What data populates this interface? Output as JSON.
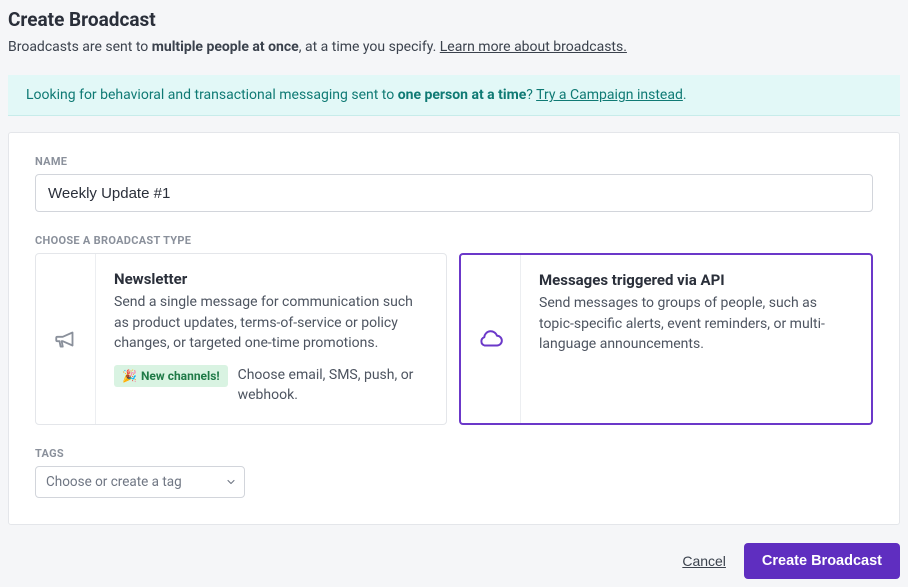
{
  "header": {
    "title": "Create Broadcast",
    "subtitle_pre": "Broadcasts are sent to ",
    "subtitle_bold": "multiple people at once",
    "subtitle_post": ", at a time you specify. ",
    "learn_more": "Learn more about broadcasts."
  },
  "banner": {
    "text_pre": "Looking for behavioral and transactional messaging sent to ",
    "text_bold": "one person at a time",
    "text_post": "? ",
    "link": "Try a Campaign instead",
    "tail": "."
  },
  "form": {
    "name_label": "NAME",
    "name_value": "Weekly Update #1",
    "type_label": "CHOOSE A BROADCAST TYPE",
    "types": {
      "newsletter": {
        "title": "Newsletter",
        "desc": "Send a single message for communication such as product updates, terms-of-service or policy changes, or targeted one-time promotions.",
        "badge": "New channels!",
        "channels_text": "Choose email, SMS, push, or webhook."
      },
      "api": {
        "title": "Messages triggered via API",
        "desc": "Send messages to groups of people, such as topic-specific alerts, event reminders, or multi-language announcements."
      }
    },
    "tags_label": "TAGS",
    "tags_placeholder": "Choose or create a tag"
  },
  "footer": {
    "cancel": "Cancel",
    "submit": "Create Broadcast"
  },
  "colors": {
    "accent": "#6b38c9"
  }
}
